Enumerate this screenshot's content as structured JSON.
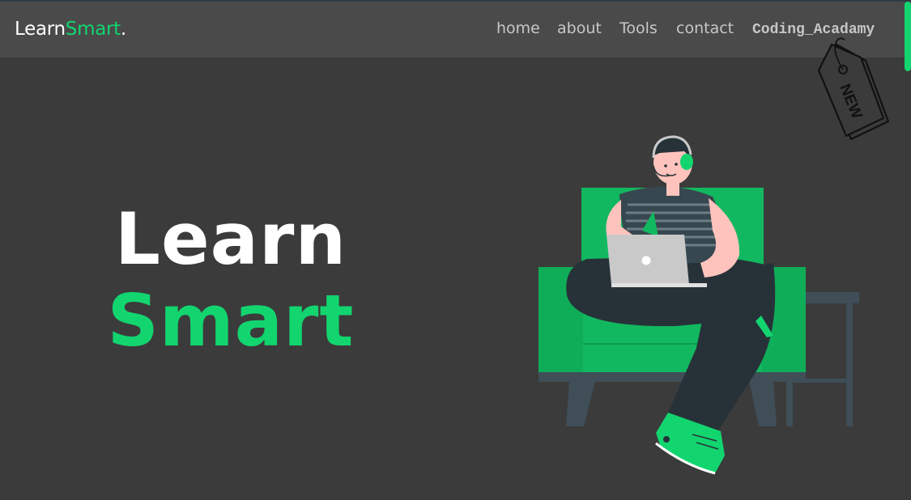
{
  "navbar": {
    "logo": {
      "part1": "Learn",
      "part2": "Smart",
      "dot": "."
    },
    "links": [
      {
        "label": "home"
      },
      {
        "label": "about"
      },
      {
        "label": "Tools"
      },
      {
        "label": "contact"
      },
      {
        "label": "Coding_Acadamy"
      }
    ],
    "badge": {
      "text": "NEW",
      "icon": "tag-icon"
    }
  },
  "hero": {
    "line1": "Learn",
    "line2": "Smart",
    "illustration": "person-with-laptop-illustration"
  },
  "colors": {
    "accent": "#12d56f",
    "background": "#3b3b3b",
    "navbar": "#4a4a4a",
    "nav_text": "#c7c7c7"
  }
}
